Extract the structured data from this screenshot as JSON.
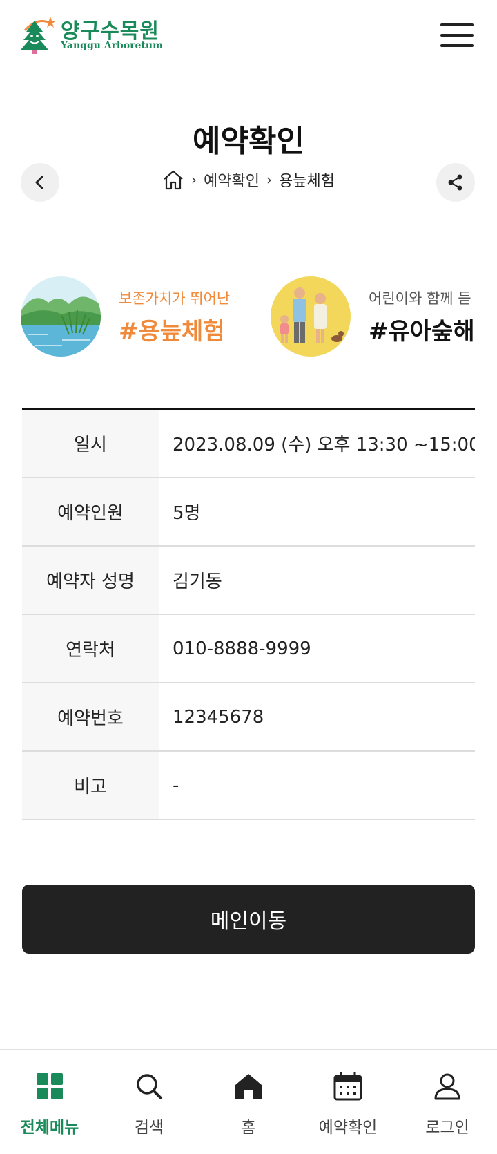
{
  "header": {
    "logo_kr": "양구수목원",
    "logo_en": "Yanggu Arboretum"
  },
  "page": {
    "title": "예약확인"
  },
  "breadcrumb": {
    "items": [
      "예약확인",
      "용늪체험"
    ]
  },
  "programs": [
    {
      "subtitle": "보존가치가 뛰어난",
      "tag": "#용늪체험"
    },
    {
      "subtitle": "어린이와 함께 듣",
      "tag": "#유아숲해"
    }
  ],
  "reservation": {
    "rows": [
      {
        "label": "일시",
        "value": "2023.08.09 (수) 오후 13:30 ~15:00"
      },
      {
        "label": "예약인원",
        "value": "5명"
      },
      {
        "label": "예약자 성명",
        "value": "김기동"
      },
      {
        "label": "연락처",
        "value": "010-8888-9999"
      },
      {
        "label": "예약번호",
        "value": "12345678"
      },
      {
        "label": "비고",
        "value": "-"
      }
    ]
  },
  "actions": {
    "main_label": "메인이동"
  },
  "bottom_nav": {
    "items": [
      {
        "label": "전체메뉴",
        "icon": "grid-icon"
      },
      {
        "label": "검색",
        "icon": "search-icon"
      },
      {
        "label": "홈",
        "icon": "home-icon"
      },
      {
        "label": "예약확인",
        "icon": "calendar-icon"
      },
      {
        "label": "로그인",
        "icon": "user-icon"
      }
    ]
  },
  "colors": {
    "brand_green": "#1a8a5a",
    "accent_orange": "#f08a3a",
    "button_dark": "#222222"
  }
}
